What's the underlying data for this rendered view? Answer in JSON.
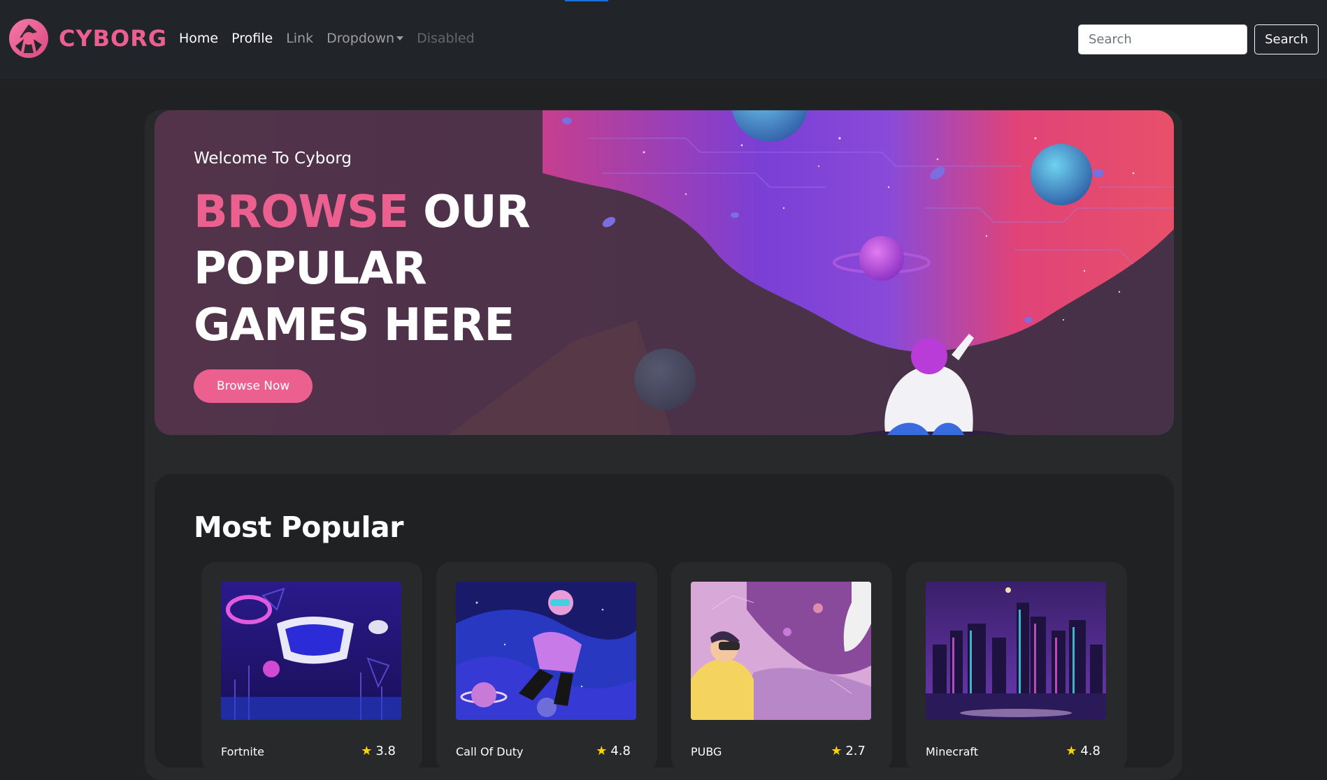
{
  "brand": {
    "name": "CYBORG"
  },
  "nav": {
    "home": "Home",
    "profile": "Profile",
    "link": "Link",
    "dropdown": "Dropdown",
    "disabled": "Disabled"
  },
  "search": {
    "placeholder": "Search",
    "button": "Search"
  },
  "banner": {
    "welcome": "Welcome To Cyborg",
    "headline_accent": "BROWSE",
    "headline_line1_rest": "OUR",
    "headline_line2": "POPULAR",
    "headline_line3": "GAMES HERE",
    "button": "Browse Now"
  },
  "popular": {
    "title": "Most Popular",
    "games": [
      {
        "name": "Fortnite",
        "rating": "3.8",
        "image": "vr-headset-neon-art"
      },
      {
        "name": "Call Of Duty",
        "rating": "4.8",
        "image": "floating-vr-astronaut-art"
      },
      {
        "name": "PUBG",
        "rating": "2.7",
        "image": "vr-girl-space-art"
      },
      {
        "name": "Minecraft",
        "rating": "4.8",
        "image": "neon-city-night-art"
      }
    ]
  },
  "colors": {
    "accent": "#ec6090",
    "background": "#1f2122",
    "panel": "#27292a",
    "star": "#fbd300"
  }
}
